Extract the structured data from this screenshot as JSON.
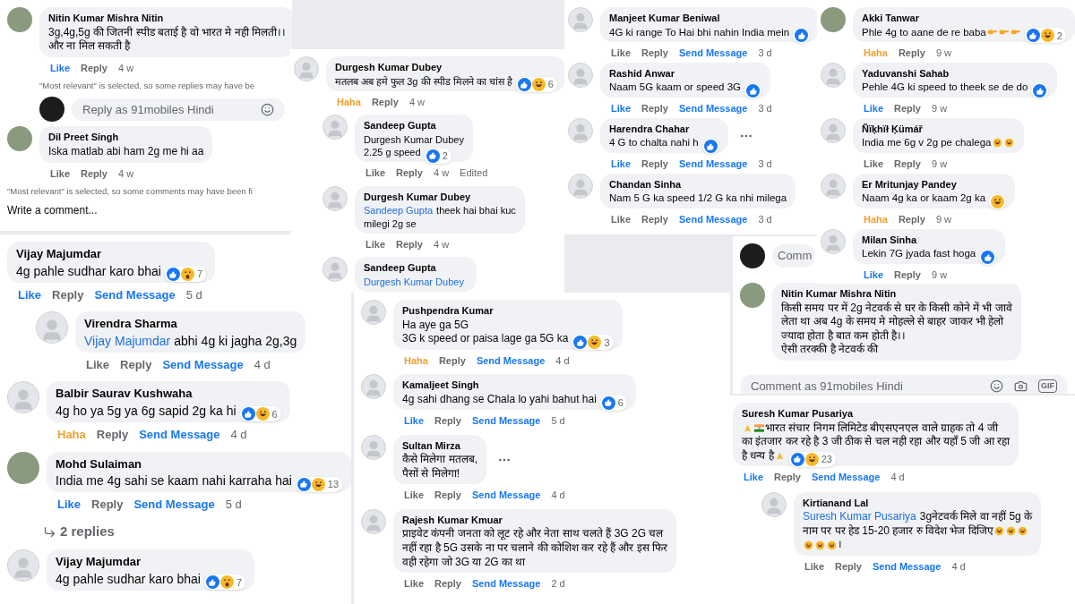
{
  "panels": [
    {
      "items": [
        {
          "kind": "comment",
          "avatar": {
            "kind": "photo"
          },
          "name": "Nitin Kumar Mishra Nitin",
          "lines": [
            [
              {
                "t": "3g,4g,5g की जितनी स्पीड बताई है वो भारत मे नही मिलती।।"
              }
            ],
            [
              {
                "t": "और ना मिल सकती है"
              }
            ]
          ],
          "actions": [
            {
              "kind": "liked",
              "label": "Like"
            },
            {
              "kind": "reply",
              "label": "Reply"
            },
            {
              "kind": "time",
              "label": "4 w"
            }
          ]
        },
        {
          "kind": "note",
          "text": "\"Most relevant\" is selected, so some replies may have be",
          "indent": true
        },
        {
          "kind": "field",
          "avatar": {
            "kind": "logo"
          },
          "placeholder": "Reply as 91mobiles Hindi",
          "icons": [
            {
              "kind": "emoji"
            }
          ],
          "indent": true
        },
        {
          "kind": "comment",
          "avatar": {
            "kind": "photo"
          },
          "name": "Dil Preet Singh",
          "lines": [
            [
              {
                "t": "Iska matlab abi ham 2g me hi aa"
              }
            ]
          ],
          "actions": [
            {
              "kind": "like",
              "label": "Like"
            },
            {
              "kind": "reply",
              "label": "Reply"
            },
            {
              "kind": "time",
              "label": "4 w"
            }
          ]
        },
        {
          "kind": "note",
          "text": "\"Most relevant\" is selected, so some comments may have been fi"
        },
        {
          "kind": "write",
          "text": "Write a comment..."
        }
      ]
    },
    {
      "items": [
        {
          "kind": "comment",
          "name": "Vijay Majumdar",
          "lines": [
            [
              {
                "t": "4g pahle sudhar karo bhai"
              }
            ]
          ],
          "reactions": {
            "icons": [
              {
                "kind": "like"
              },
              {
                "kind": "wow"
              }
            ],
            "count": "7"
          },
          "actions": [
            {
              "kind": "liked",
              "label": "Like"
            },
            {
              "kind": "reply",
              "label": "Reply"
            },
            {
              "kind": "send",
              "label": "Send Message"
            },
            {
              "kind": "time",
              "label": "5 d"
            }
          ]
        },
        {
          "kind": "comment",
          "reply": true,
          "avatar": {
            "kind": "blank"
          },
          "name": "Virendra Sharma",
          "lines": [
            [
              {
                "mention": "Vijay Majumdar"
              },
              {
                "t": "abhi 4g ki jagha 2g,3g"
              }
            ]
          ],
          "actions": [
            {
              "kind": "like",
              "label": "Like"
            },
            {
              "kind": "reply",
              "label": "Reply"
            },
            {
              "kind": "send",
              "label": "Send Message"
            },
            {
              "kind": "time",
              "label": "4 d"
            }
          ]
        },
        {
          "kind": "comment",
          "avatar": {
            "kind": "blank"
          },
          "name": "Balbir Saurav Kushwaha",
          "lines": [
            [
              {
                "t": "4g ho ya 5g ya 6g sapid 2g ka hi"
              }
            ]
          ],
          "reactions": {
            "icons": [
              {
                "kind": "like"
              },
              {
                "kind": "haha"
              }
            ],
            "count": "6"
          },
          "actions": [
            {
              "kind": "haha",
              "label": "Haha"
            },
            {
              "kind": "reply",
              "label": "Reply"
            },
            {
              "kind": "send",
              "label": "Send Message"
            },
            {
              "kind": "time",
              "label": "4 d"
            }
          ]
        },
        {
          "kind": "comment",
          "avatar": {
            "kind": "photo"
          },
          "name": "Mohd Sulaiman",
          "lines": [
            [
              {
                "t": "India me 4g sahi se kaam nahi karraha hai"
              }
            ]
          ],
          "reactions": {
            "icons": [
              {
                "kind": "like"
              },
              {
                "kind": "haha"
              }
            ],
            "count": "13"
          },
          "actions": [
            {
              "kind": "liked",
              "label": "Like"
            },
            {
              "kind": "reply",
              "label": "Reply"
            },
            {
              "kind": "send",
              "label": "Send Message"
            },
            {
              "kind": "time",
              "label": "5 d"
            }
          ]
        },
        {
          "kind": "replies",
          "text": "2 replies"
        },
        {
          "kind": "comment",
          "avatar": {
            "kind": "blank"
          },
          "name": "Vijay Majumdar",
          "lines": [
            [
              {
                "t": "4g pahle sudhar karo bhai"
              }
            ]
          ],
          "reactions": {
            "icons": [
              {
                "kind": "like"
              },
              {
                "kind": "wow"
              }
            ],
            "count": "7"
          }
        }
      ]
    },
    {
      "items": [
        {
          "kind": "comment",
          "avatar": {
            "kind": "blank"
          },
          "name": "Durgesh Kumar Dubey",
          "lines": [
            [
              {
                "t": "मतलब अब हमे फुल 3g की स्पीड मिलने का चांस है"
              }
            ]
          ],
          "reactions": {
            "icons": [
              {
                "kind": "like"
              },
              {
                "kind": "haha"
              }
            ],
            "count": "6"
          },
          "actions": [
            {
              "kind": "haha",
              "label": "Haha"
            },
            {
              "kind": "reply",
              "label": "Reply"
            },
            {
              "kind": "time",
              "label": "4 w"
            }
          ]
        },
        {
          "kind": "comment",
          "reply": true,
          "avatar": {
            "kind": "blank"
          },
          "name": "Sandeep Gupta",
          "lines": [
            [
              {
                "t": "Durgesh Kumar Dubey"
              }
            ],
            [
              {
                "t": "2.25 g speed"
              }
            ]
          ],
          "reactions": {
            "icons": [
              {
                "kind": "like"
              }
            ],
            "count": "2"
          },
          "actions": [
            {
              "kind": "like",
              "label": "Like"
            },
            {
              "kind": "reply",
              "label": "Reply"
            },
            {
              "kind": "time",
              "label": "4 w"
            },
            {
              "kind": "edited",
              "label": "Edited"
            }
          ]
        },
        {
          "kind": "comment",
          "reply": true,
          "avatar": {
            "kind": "blank"
          },
          "name": "Durgesh Kumar Dubey",
          "lines": [
            [
              {
                "mention": "Sandeep Gupta"
              },
              {
                "t": "theek hai bhai kuc"
              }
            ],
            [
              {
                "t": "milegi 2g se"
              }
            ]
          ],
          "actions": [
            {
              "kind": "like",
              "label": "Like"
            },
            {
              "kind": "reply",
              "label": "Reply"
            },
            {
              "kind": "time",
              "label": "4 w"
            }
          ]
        },
        {
          "kind": "comment",
          "reply": true,
          "avatar": {
            "kind": "blank"
          },
          "name": "Sandeep Gupta",
          "lines": [
            [
              {
                "mention": "Durgesh Kumar Dubey"
              }
            ]
          ]
        }
      ]
    },
    {
      "items": [
        {
          "kind": "comment",
          "avatar": {
            "kind": "blank"
          },
          "name": "Pushpendra Kumar",
          "lines": [
            [
              {
                "t": "Ha aye ga 5G"
              }
            ],
            [
              {
                "t": "3G k speed or paisa lage ga 5G ka"
              }
            ]
          ],
          "reactions": {
            "icons": [
              {
                "kind": "like"
              },
              {
                "kind": "haha"
              }
            ],
            "count": "3"
          },
          "actions": [
            {
              "kind": "haha",
              "label": "Haha"
            },
            {
              "kind": "reply",
              "label": "Reply"
            },
            {
              "kind": "send",
              "label": "Send Message"
            },
            {
              "kind": "time",
              "label": "4 d"
            }
          ]
        },
        {
          "kind": "comment",
          "avatar": {
            "kind": "blank"
          },
          "name": "Kamaljeet Singh",
          "lines": [
            [
              {
                "t": "4g sahi dhang se Chala lo yahi bahut hai"
              }
            ]
          ],
          "reactions": {
            "icons": [
              {
                "kind": "like"
              }
            ],
            "count": "6"
          },
          "actions": [
            {
              "kind": "liked",
              "label": "Like"
            },
            {
              "kind": "reply",
              "label": "Reply"
            },
            {
              "kind": "send",
              "label": "Send Message"
            },
            {
              "kind": "time",
              "label": "5 d"
            }
          ]
        },
        {
          "kind": "comment",
          "avatar": {
            "kind": "blank"
          },
          "name": "Sultan Mirza",
          "lines": [
            [
              {
                "t": "कैसे मिलेगा मतलब,"
              }
            ],
            [
              {
                "t": "पैसों से मिलेगा!"
              }
            ]
          ],
          "menu": true,
          "actions": [
            {
              "kind": "like",
              "label": "Like"
            },
            {
              "kind": "reply",
              "label": "Reply"
            },
            {
              "kind": "send",
              "label": "Send Message"
            },
            {
              "kind": "time",
              "label": "4 d"
            }
          ]
        },
        {
          "kind": "comment",
          "avatar": {
            "kind": "blank"
          },
          "name": "Rajesh Kumar Kmuar",
          "lines": [
            [
              {
                "t": "प्राइवेट कंपनी जनता को लूट रहे और नेता साथ चलते हैं 3G 2G चल"
              }
            ],
            [
              {
                "t": "नहीं रहा है 5G उसके ना पर चलाने की कोशिश कर रहे हैं और इस फिर"
              }
            ],
            [
              {
                "t": "वही रहेगा जो 3G या 2G का था"
              }
            ]
          ],
          "actions": [
            {
              "kind": "like",
              "label": "Like"
            },
            {
              "kind": "reply",
              "label": "Reply"
            },
            {
              "kind": "send",
              "label": "Send Message"
            },
            {
              "kind": "time",
              "label": "2 d"
            }
          ]
        }
      ]
    },
    {
      "items": [
        {
          "kind": "comment",
          "avatar": {
            "kind": "blank"
          },
          "name": "Manjeet Kumar Beniwal",
          "lines": [
            [
              {
                "t": "4G ki range To Hai bhi nahin India mein"
              }
            ]
          ],
          "reactions": {
            "icons": [
              {
                "kind": "like"
              }
            ]
          },
          "actions": [
            {
              "kind": "like",
              "label": "Like"
            },
            {
              "kind": "reply",
              "label": "Reply"
            },
            {
              "kind": "send",
              "label": "Send Message"
            },
            {
              "kind": "time",
              "label": "3 d"
            }
          ]
        },
        {
          "kind": "comment",
          "avatar": {
            "kind": "blank"
          },
          "name": "Rashid Anwar",
          "lines": [
            [
              {
                "t": "Naam 5G kaam or speed 3G"
              }
            ]
          ],
          "reactions": {
            "icons": [
              {
                "kind": "like"
              }
            ]
          },
          "actions": [
            {
              "kind": "liked",
              "label": "Like"
            },
            {
              "kind": "reply",
              "label": "Reply"
            },
            {
              "kind": "send",
              "label": "Send Message"
            },
            {
              "kind": "time",
              "label": "3 d"
            }
          ]
        },
        {
          "kind": "comment",
          "avatar": {
            "kind": "blank"
          },
          "name": "Harendra Chahar",
          "lines": [
            [
              {
                "t": "4 G to chalta nahi h"
              }
            ]
          ],
          "reactions": {
            "icons": [
              {
                "kind": "like"
              }
            ]
          },
          "menu": true,
          "actions": [
            {
              "kind": "liked",
              "label": "Like"
            },
            {
              "kind": "reply",
              "label": "Reply"
            },
            {
              "kind": "send",
              "label": "Send Message"
            },
            {
              "kind": "time",
              "label": "3 d"
            }
          ]
        },
        {
          "kind": "comment",
          "avatar": {
            "kind": "blank"
          },
          "name": "Chandan Sinha",
          "lines": [
            [
              {
                "t": "Nam 5 G ka speed 1/2 G ka nhi milega"
              }
            ]
          ],
          "actions": [
            {
              "kind": "like",
              "label": "Like"
            },
            {
              "kind": "reply",
              "label": "Reply"
            },
            {
              "kind": "send",
              "label": "Send Message"
            },
            {
              "kind": "time",
              "label": "3 d"
            }
          ]
        }
      ]
    },
    {
      "items": [
        {
          "kind": "field",
          "avatar": {
            "kind": "logo"
          },
          "placeholder": "Comm",
          "short": true
        },
        {
          "kind": "comment",
          "avatar": {
            "kind": "photo"
          },
          "name": "Nitin Kumar Mishra Nitin",
          "lines": [
            [
              {
                "t": "किसी समय पर में 2g नेटवर्क से घर के किसी कोने में भी जावे"
              }
            ],
            [
              {
                "t": "लेता था अब 4g के समय मे मोहल्ले से बाहर जाकर भी हेलो"
              }
            ],
            [
              {
                "t": "ज्यादा होता है बात कम होती है।।"
              }
            ],
            [
              {
                "t": "ऐसी तरक्की है नेटवर्क की"
              }
            ]
          ]
        },
        {
          "kind": "field",
          "placeholder": "Comment as 91mobiles Hindi",
          "icons": [
            {
              "kind": "emoji"
            },
            {
              "kind": "camera"
            },
            {
              "kind": "gif",
              "label": "GIF"
            }
          ]
        }
      ]
    },
    {
      "items": [
        {
          "kind": "comment",
          "avatar": {
            "kind": "photo"
          },
          "name": "Akki Tanwar",
          "lines": [
            [
              {
                "t": "Phle 4g to aane de re baba"
              },
              {
                "kind": "point"
              },
              {
                "kind": "point"
              },
              {
                "kind": "point"
              }
            ]
          ],
          "reactions": {
            "icons": [
              {
                "kind": "like"
              },
              {
                "kind": "haha"
              }
            ],
            "count": "2"
          },
          "actions": [
            {
              "kind": "haha",
              "label": "Haha"
            },
            {
              "kind": "reply",
              "label": "Reply"
            },
            {
              "kind": "time",
              "label": "9 w"
            }
          ]
        },
        {
          "kind": "comment",
          "avatar": {
            "kind": "blank"
          },
          "name": "Yaduvanshi Sahab",
          "lines": [
            [
              {
                "t": "Pehle 4G ki speed to theek se de do"
              }
            ]
          ],
          "reactions": {
            "icons": [
              {
                "kind": "like"
              }
            ]
          },
          "actions": [
            {
              "kind": "liked",
              "label": "Like"
            },
            {
              "kind": "reply",
              "label": "Reply"
            },
            {
              "kind": "time",
              "label": "9 w"
            }
          ]
        },
        {
          "kind": "comment",
          "avatar": {
            "kind": "blank"
          },
          "name": "Ñïķhïł Ķümář",
          "lines": [
            [
              {
                "t": "India me 6g v 2g pe chalega"
              },
              {
                "kind": "laugh"
              },
              {
                "kind": "laugh"
              }
            ]
          ],
          "actions": [
            {
              "kind": "like",
              "label": "Like"
            },
            {
              "kind": "reply",
              "label": "Reply"
            },
            {
              "kind": "time",
              "label": "9 w"
            }
          ]
        },
        {
          "kind": "comment",
          "avatar": {
            "kind": "blank"
          },
          "name": "Er Mritunjay Pandey",
          "lines": [
            [
              {
                "t": "Naam 4g ka or kaam 2g ka"
              }
            ]
          ],
          "reactions": {
            "icons": [
              {
                "kind": "haha"
              }
            ]
          },
          "actions": [
            {
              "kind": "haha",
              "label": "Haha"
            },
            {
              "kind": "reply",
              "label": "Reply"
            },
            {
              "kind": "time",
              "label": "9 w"
            }
          ]
        },
        {
          "kind": "comment",
          "avatar": {
            "kind": "blank"
          },
          "name": "Milan Sinha",
          "lines": [
            [
              {
                "t": "Lekin 7G jyada fast hoga"
              }
            ]
          ],
          "reactions": {
            "icons": [
              {
                "kind": "like"
              }
            ]
          },
          "actions": [
            {
              "kind": "liked",
              "label": "Like"
            },
            {
              "kind": "reply",
              "label": "Reply"
            },
            {
              "kind": "time",
              "label": "9 w"
            }
          ]
        }
      ]
    },
    {
      "items": [
        {
          "kind": "comment",
          "name": "Suresh Kumar Pusariya",
          "lines": [
            [
              {
                "kind": "pray"
              },
              {
                "kind": "flag"
              },
              {
                "t": "भारत संचार निगम लिमिटेड बीएसएनएल वाले ग्राहक तो 4 जी"
              }
            ],
            [
              {
                "t": "का इंतजार कर रहे है 3 जी ठीक से चल नही रहा और यहाँ 5 जी आ रहा"
              }
            ],
            [
              {
                "t": "है धन्य है"
              },
              {
                "kind": "pray"
              }
            ]
          ],
          "reactions": {
            "icons": [
              {
                "kind": "like"
              },
              {
                "kind": "haha"
              }
            ],
            "count": "23"
          },
          "actions": [
            {
              "kind": "liked",
              "label": "Like"
            },
            {
              "kind": "reply",
              "label": "Reply"
            },
            {
              "kind": "send",
              "label": "Send Message"
            },
            {
              "kind": "time",
              "label": "4 d"
            }
          ]
        },
        {
          "kind": "comment",
          "reply": true,
          "avatar": {
            "kind": "blank"
          },
          "name": "Kirtianand Lal",
          "lines": [
            [
              {
                "mention": "Suresh Kumar Pusariya"
              },
              {
                "t": "3gनेटवर्क मिले वा नहीं 5g के"
              }
            ],
            [
              {
                "t": "नाम पर पर हेड 15-20 हजार रु विदेश भेज दिजिए"
              },
              {
                "kind": "laugh"
              },
              {
                "kind": "laugh"
              },
              {
                "kind": "laugh"
              }
            ],
            [
              {
                "kind": "laugh"
              },
              {
                "kind": "laugh"
              },
              {
                "kind": "laugh"
              },
              {
                "t": "।"
              }
            ]
          ],
          "actions": [
            {
              "kind": "like",
              "label": "Like"
            },
            {
              "kind": "reply",
              "label": "Reply"
            },
            {
              "kind": "send",
              "label": "Send Message"
            },
            {
              "kind": "time",
              "label": "4 d"
            }
          ]
        }
      ]
    }
  ]
}
